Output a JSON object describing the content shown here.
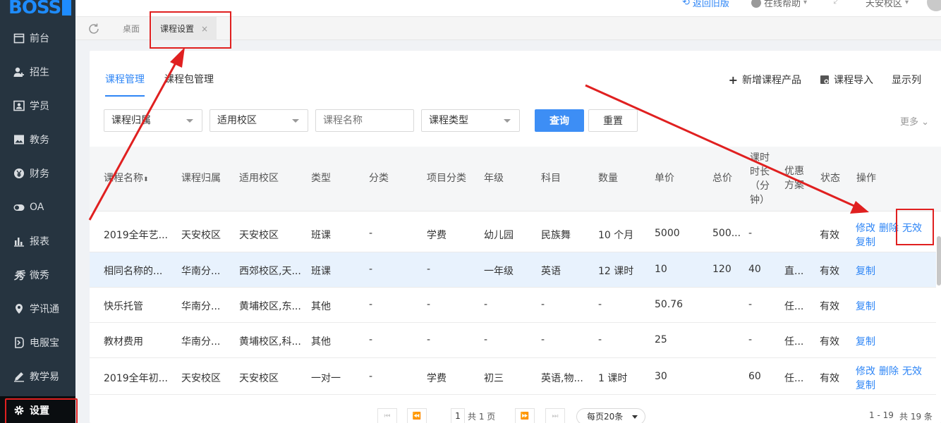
{
  "brand": {
    "logo_text": "BOSS"
  },
  "sidebar": {
    "items": [
      {
        "label": "前台",
        "icon": "calendar-icon"
      },
      {
        "label": "招生",
        "icon": "user-add-icon"
      },
      {
        "label": "学员",
        "icon": "id-card-icon"
      },
      {
        "label": "教务",
        "icon": "picture-icon"
      },
      {
        "label": "财务",
        "icon": "yen-icon"
      },
      {
        "label": "OA",
        "icon": "toggle-icon"
      },
      {
        "label": "报表",
        "icon": "bar-chart-icon"
      },
      {
        "label": "微秀",
        "icon": "xiu-icon"
      },
      {
        "label": "学讯通",
        "icon": "location-icon"
      },
      {
        "label": "电服宝",
        "icon": "phone-shield-icon"
      },
      {
        "label": "教学易",
        "icon": "pen-icon"
      },
      {
        "label": "设置",
        "icon": "gear-icon"
      }
    ]
  },
  "header": {
    "back_old": "返回旧版",
    "help": "在线帮助",
    "campus": "天安校区"
  },
  "tabs": {
    "desktop": "桌面",
    "course_settings": "课程设置",
    "close": "×"
  },
  "subtabs": {
    "course_mgmt": "课程管理",
    "package_mgmt": "课程包管理"
  },
  "actions": {
    "add_product": "新增课程产品",
    "import": "课程导入",
    "columns": "显示列"
  },
  "filters": {
    "belong": "课程归属",
    "campus": "适用校区",
    "name_placeholder": "课程名称",
    "type": "课程类型",
    "query": "查询",
    "reset": "重置",
    "more": "更多"
  },
  "table": {
    "headers": {
      "name": "课程名称",
      "belong": "课程归属",
      "campus": "适用校区",
      "type": "类型",
      "category": "分类",
      "project": "项目分类",
      "grade": "年级",
      "subject": "科目",
      "qty": "数量",
      "price": "单价",
      "total": "总价",
      "duration_1": "课时",
      "duration_2": "时长",
      "duration_3": "（分",
      "duration_4": "钟）",
      "discount_1": "优惠",
      "discount_2": "方案",
      "status": "状态",
      "ops": "操作"
    },
    "rows": [
      {
        "name": "2019全年艺...",
        "belong": "天安校区",
        "campus": "天安校区",
        "type": "班课",
        "category": "-",
        "project": "学费",
        "grade": "幼儿园",
        "subject": "民族舞",
        "qty": "10 个月",
        "price": "5000",
        "total": "500...",
        "duration": "-",
        "discount": "",
        "status": "有效",
        "op_edit": "修改",
        "op_delete": "删除",
        "op_invalid": "无效",
        "op_copy": "复制"
      },
      {
        "name": "相同名称的...",
        "belong": "华南分...",
        "campus": "西郊校区,天...",
        "type": "班课",
        "category": "-",
        "project": "-",
        "grade": "一年级",
        "subject": "英语",
        "qty": "12 课时",
        "price": "10",
        "total": "120",
        "duration": "40",
        "discount": "直...",
        "status": "有效",
        "op_copy": "复制"
      },
      {
        "name": "快乐托管",
        "belong": "华南分...",
        "campus": "黄埔校区,东...",
        "type": "其他",
        "category": "-",
        "project": "-",
        "grade": "-",
        "subject": "-",
        "qty": "-",
        "price": "50.76",
        "total": "",
        "duration": "-",
        "discount": "任...",
        "status": "有效",
        "op_copy": "复制"
      },
      {
        "name": "教材费用",
        "belong": "华南分...",
        "campus": "黄埔校区,科...",
        "type": "其他",
        "category": "-",
        "project": "-",
        "grade": "-",
        "subject": "-",
        "qty": "-",
        "price": "25",
        "total": "",
        "duration": "-",
        "discount": "任...",
        "status": "有效",
        "op_copy": "复制"
      },
      {
        "name": "2019全年初...",
        "belong": "天安校区",
        "campus": "天安校区",
        "type": "一对一",
        "category": "-",
        "project": "学费",
        "grade": "初三",
        "subject": "英语,物...",
        "qty": "1 课时",
        "price": "30",
        "total": "",
        "duration": "60",
        "discount": "任...",
        "status": "有效",
        "op_edit": "修改",
        "op_delete": "删除",
        "op_invalid": "无效",
        "op_copy": "复制"
      }
    ]
  },
  "pager": {
    "page": "1",
    "total_pages": "共 1 页",
    "page_size": "每页20条",
    "range": "1 - 19",
    "total": "共 19 条"
  },
  "colors": {
    "accent": "#2f86f6",
    "sidebar": "#263440",
    "annotation": "#e02020"
  }
}
